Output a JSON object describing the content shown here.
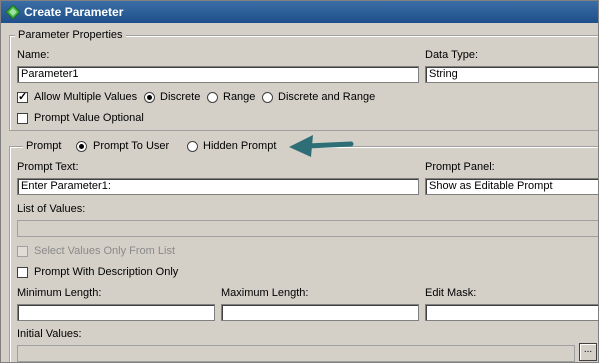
{
  "window": {
    "title": "Create Parameter"
  },
  "parameter_properties": {
    "legend": "Parameter Properties",
    "name_label": "Name:",
    "name_value": "Parameter1",
    "data_type_label": "Data Type:",
    "data_type_value": "String",
    "allow_multiple_label": "Allow Multiple Values",
    "allow_multiple_checked": true,
    "discrete_label": "Discrete",
    "range_label": "Range",
    "discrete_and_range_label": "Discrete and Range",
    "selected_mode": "Discrete",
    "prompt_value_optional_label": "Prompt Value Optional",
    "prompt_value_optional_checked": false
  },
  "prompt": {
    "legend": "Prompt",
    "prompt_to_user_label": "Prompt To User",
    "hidden_prompt_label": "Hidden Prompt",
    "selected": "Prompt To User",
    "prompt_text_label": "Prompt Text:",
    "prompt_text_value": "Enter Parameter1:",
    "prompt_panel_label": "Prompt Panel:",
    "prompt_panel_value": "Show as Editable Prompt",
    "list_of_values_label": "List of Values:",
    "select_values_only_label": "Select Values Only From List",
    "prompt_with_description_label": "Prompt With Description Only",
    "min_length_label": "Minimum Length:",
    "max_length_label": "Maximum Length:",
    "edit_mask_label": "Edit Mask:",
    "initial_values_label": "Initial Values:",
    "browse_button_label": "..."
  },
  "colors": {
    "title_bar": "#1f4f8a",
    "arrow": "#2e6f77",
    "dialog_bg": "#d4d0c8"
  }
}
